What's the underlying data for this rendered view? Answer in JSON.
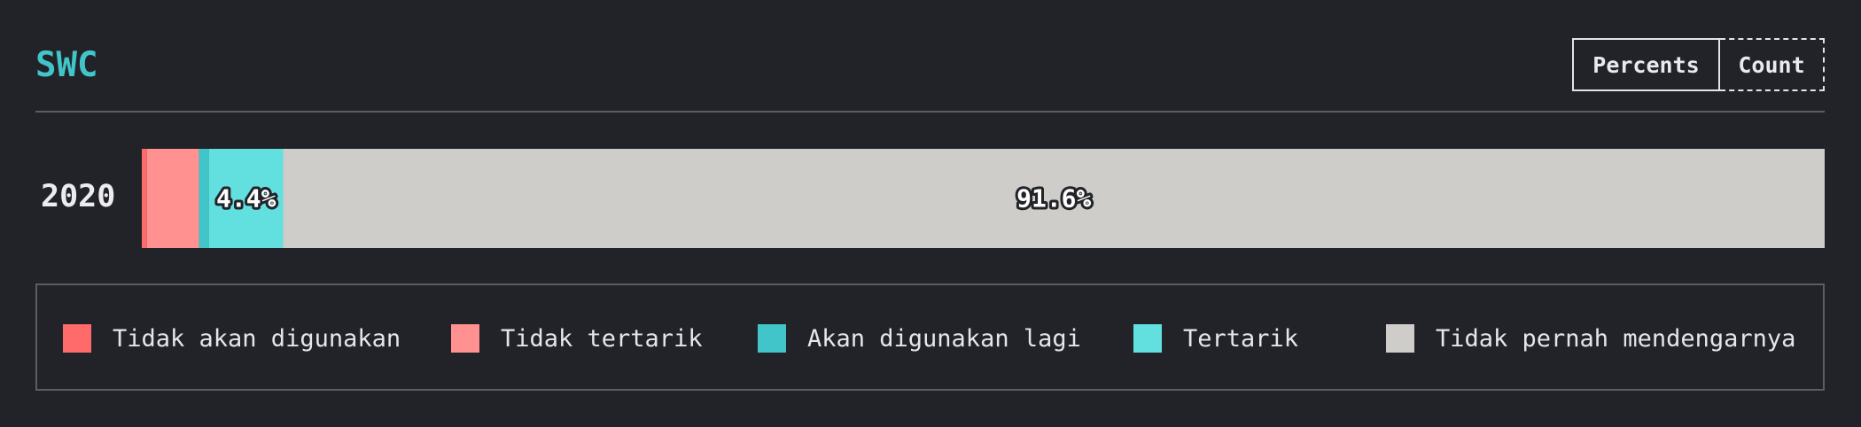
{
  "header": {
    "title": "SWC",
    "toggle": {
      "percents_label": "Percents",
      "count_label": "Count",
      "active": "Percents"
    }
  },
  "chart_data": {
    "type": "bar",
    "orientation": "horizontal",
    "stacked": true,
    "categories": [
      "2020"
    ],
    "xlim": [
      0,
      100
    ],
    "series": [
      {
        "name": "Tidak akan digunakan",
        "values": [
          0.3
        ],
        "color": "#ff6b6b"
      },
      {
        "name": "Tidak tertarik",
        "values": [
          3.1
        ],
        "color": "#ff9191"
      },
      {
        "name": "Akan digunakan lagi",
        "values": [
          0.6
        ],
        "color": "#41c5c9"
      },
      {
        "name": "Tertarik",
        "values": [
          4.4
        ],
        "color": "#62e0e0"
      },
      {
        "name": "Tidak pernah mendengarnya",
        "values": [
          91.6
        ],
        "color": "#cfcdca"
      }
    ],
    "data_labels": [
      {
        "series": "Tertarik",
        "category": "2020",
        "text": "4.4%"
      },
      {
        "series": "Tidak pernah mendengarnya",
        "category": "2020",
        "text": "91.6%"
      }
    ],
    "legend": {
      "position": "bottom"
    }
  }
}
